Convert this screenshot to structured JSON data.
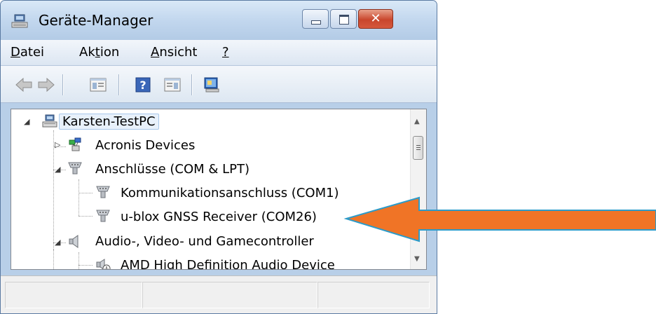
{
  "window": {
    "title": "Geräte-Manager",
    "close_glyph": "✕"
  },
  "menu": [
    {
      "pre": "",
      "mnemonic": "D",
      "post": "atei"
    },
    {
      "pre": "Ak",
      "mnemonic": "t",
      "post": "ion"
    },
    {
      "pre": "",
      "mnemonic": "A",
      "post": "nsicht"
    },
    {
      "pre": "",
      "mnemonic": "?",
      "post": ""
    }
  ],
  "toolbar": {
    "icons": [
      "back-arrow-icon",
      "forward-arrow-icon",
      "show-hide-console-tree-icon",
      "help-icon",
      "action-pane-icon",
      "properties-monitor-icon"
    ]
  },
  "tree": {
    "root": "Karsten-TestPC",
    "items": [
      {
        "label": "Acronis Devices",
        "icon": "network-device-icon",
        "expander": "▷"
      },
      {
        "label": "Anschlüsse (COM & LPT)",
        "icon": "port-connector-icon",
        "expander": "◢"
      },
      {
        "label": "Kommunikationsanschluss (COM1)",
        "icon": "port-connector-icon"
      },
      {
        "label": "u-blox GNSS Receiver (COM26)",
        "icon": "port-connector-icon"
      },
      {
        "label": "Audio-, Video- und Gamecontroller",
        "icon": "speaker-icon",
        "expander": "◢"
      },
      {
        "label": "AMD High Definition Audio Device",
        "icon": "audio-device-icon"
      }
    ]
  },
  "annotation": {
    "arrow_color": "#f07426",
    "arrow_outline": "#2c9bc9"
  }
}
